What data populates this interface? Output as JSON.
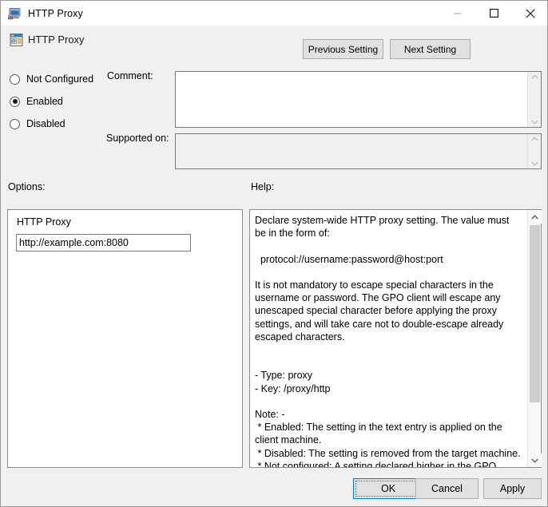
{
  "window": {
    "title": "HTTP Proxy",
    "title_icon": "computer-monitor-icon",
    "minimize_label": "—",
    "maximize_label": "☐",
    "close_label": "✕"
  },
  "header": {
    "setting_icon": "policy-setting-icon",
    "setting_name": "HTTP Proxy",
    "previous_setting_label": "Previous Setting",
    "next_setting_label": "Next Setting"
  },
  "state": {
    "options": [
      {
        "id": "not-configured",
        "label": "Not Configured",
        "selected": false
      },
      {
        "id": "enabled",
        "label": "Enabled",
        "selected": true
      },
      {
        "id": "disabled",
        "label": "Disabled",
        "selected": false
      }
    ],
    "selected": "Enabled"
  },
  "comment": {
    "label": "Comment:",
    "value": "",
    "placeholder": ""
  },
  "supported_on": {
    "label": "Supported on:",
    "value": ""
  },
  "sections": {
    "options_label": "Options:",
    "help_label": "Help:"
  },
  "options_panel": {
    "field_label": "HTTP Proxy",
    "input_value": "http://example.com:8080",
    "input_placeholder": ""
  },
  "help_panel": {
    "text": "Declare system-wide HTTP proxy setting. The value must be in the form of:\n\n  protocol://username:password@host:port\n\nIt is not mandatory to escape special characters in the username or password. The GPO client will escape any unescaped special character before applying the proxy settings, and will take care not to double-escape already escaped characters.\n\n\n- Type: proxy\n- Key: /proxy/http\n\nNote: -\n * Enabled: The setting in the text entry is applied on the client machine.\n * Disabled: The setting is removed from the target machine.\n * Not configured: A setting declared higher in the GPO hierarchy will be used if available."
  },
  "footer": {
    "ok_label": "OK",
    "cancel_label": "Cancel",
    "apply_label": "Apply"
  },
  "colors": {
    "accent": "#0078d7",
    "dialog_background": "#f0f0f0",
    "field_background": "#ffffff",
    "readonly_background": "#f0f0f0",
    "border": "#8c8c8c"
  }
}
